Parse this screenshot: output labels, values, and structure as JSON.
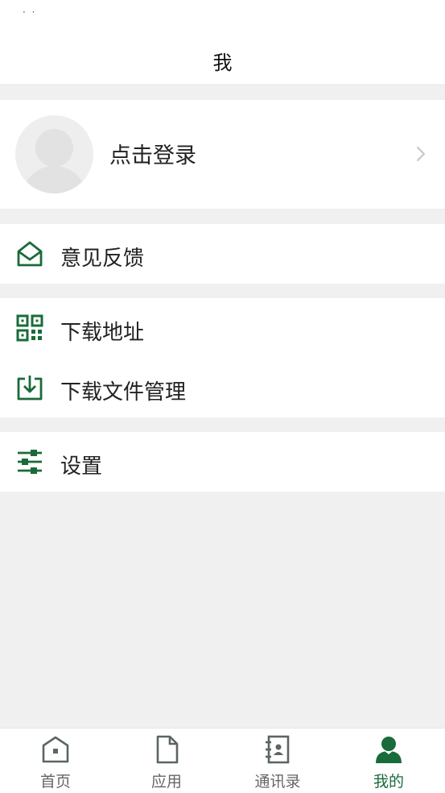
{
  "status_bar": {
    "fragment": "· ·"
  },
  "header": {
    "title": "我"
  },
  "profile": {
    "login_label": "点击登录"
  },
  "menu": {
    "feedback": "意见反馈",
    "download_address": "下载地址",
    "download_manager": "下载文件管理",
    "settings": "设置"
  },
  "tabs": [
    {
      "label": "首页",
      "icon": "home-icon",
      "active": false
    },
    {
      "label": "应用",
      "icon": "document-icon",
      "active": false
    },
    {
      "label": "通讯录",
      "icon": "contacts-book-icon",
      "active": false
    },
    {
      "label": "我的",
      "icon": "profile-icon",
      "active": true
    }
  ],
  "colors": {
    "accent": "#1a6b3a",
    "icon_gray": "#5b6565",
    "background": "#f0f0f0"
  }
}
